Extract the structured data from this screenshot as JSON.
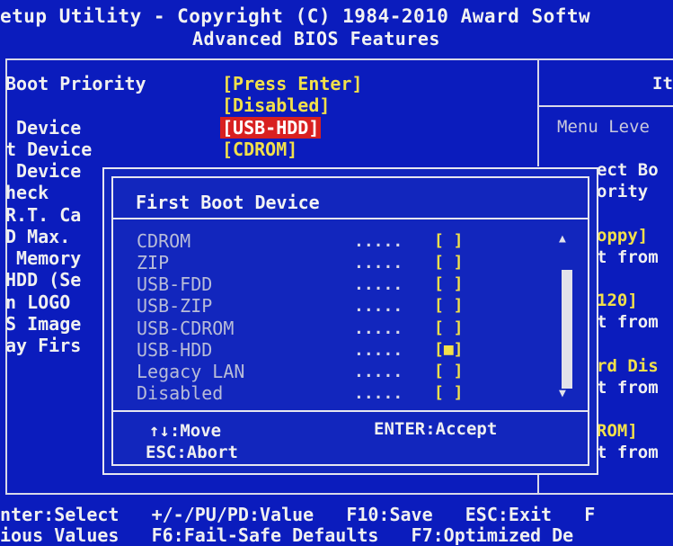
{
  "header": {
    "title_line1": "etup Utility - Copyright (C) 1984-2010 Award Softw",
    "title_line2": "Advanced BIOS Features"
  },
  "settings": [
    {
      "label": "Boot Priority",
      "value": "[Press Enter]"
    },
    {
      "label": "",
      "value": "[Disabled]"
    },
    {
      "label": " Device",
      "value": "[USB-HDD]"
    },
    {
      "label": "t Device",
      "value": "[CDROM]"
    },
    {
      "label": " Device",
      "value": ""
    },
    {
      "label": "heck",
      "value": ""
    },
    {
      "label": "R.T. Ca",
      "value": ""
    },
    {
      "label": "D Max.",
      "value": ""
    },
    {
      "label": " Memory",
      "value": ""
    },
    {
      "label": "HDD (Se",
      "value": ""
    },
    {
      "label": "n LOGO",
      "value": ""
    },
    {
      "label": "S Image",
      "value": ""
    },
    {
      "label": "ay Firs",
      "value": ""
    }
  ],
  "right_panel": {
    "header": "It",
    "menu_level": "Menu Leve",
    "lines": [
      "ect Bo",
      "ority",
      "oppy]",
      "t from",
      "120]",
      "t from",
      "rd Dis",
      "t from",
      "ROM]",
      "t from"
    ]
  },
  "popup": {
    "title": "First Boot Device",
    "options": [
      {
        "label": "CDROM",
        "dots": ".....",
        "mark": "[ ]"
      },
      {
        "label": "ZIP",
        "dots": ".....",
        "mark": "[ ]"
      },
      {
        "label": "USB-FDD",
        "dots": ".....",
        "mark": "[ ]"
      },
      {
        "label": "USB-ZIP",
        "dots": ".....",
        "mark": "[ ]"
      },
      {
        "label": "USB-CDROM",
        "dots": ".....",
        "mark": "[ ]"
      },
      {
        "label": "USB-HDD",
        "dots": ".....",
        "mark": "[■]"
      },
      {
        "label": "Legacy LAN",
        "dots": ".....",
        "mark": "[ ]"
      },
      {
        "label": "Disabled",
        "dots": ".....",
        "mark": "[ ]"
      }
    ],
    "scroll_up": "▲",
    "scroll_down": "▼",
    "hint_move": "↑↓:Move",
    "hint_accept": "ENTER:Accept",
    "hint_abort": "ESC:Abort"
  },
  "footer": {
    "line1": "nter:Select   +/-/PU/PD:Value   F10:Save   ESC:Exit   F",
    "line2": "ious Values   F6:Fail-Safe Defaults   F7:Optimized De"
  },
  "colors": {
    "background": "#0a18b8",
    "value_yellow": "#f2e04a",
    "highlight_red": "#d82020",
    "text_white": "#f0f0f0"
  }
}
